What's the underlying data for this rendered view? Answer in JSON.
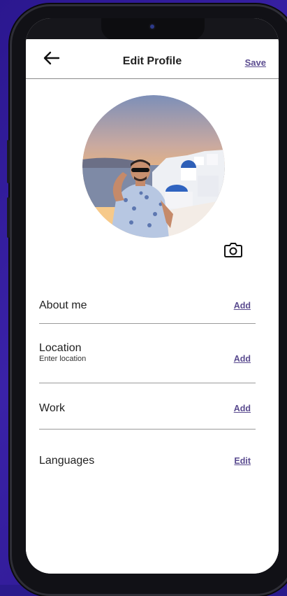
{
  "header": {
    "title": "Edit Profile",
    "save_label": "Save"
  },
  "profile": {
    "avatar_alt": ""
  },
  "fields": [
    {
      "label": "About me",
      "sub": "",
      "action": "Add"
    },
    {
      "label": "Location",
      "sub": "Enter location",
      "action": "Add"
    },
    {
      "label": "Work",
      "sub": "",
      "action": "Add"
    },
    {
      "label": "Languages",
      "sub": "",
      "action": "Edit"
    }
  ],
  "colors": {
    "accent": "#5a4b8f",
    "background": "#2b178f",
    "divider": "#9a9a9a"
  }
}
